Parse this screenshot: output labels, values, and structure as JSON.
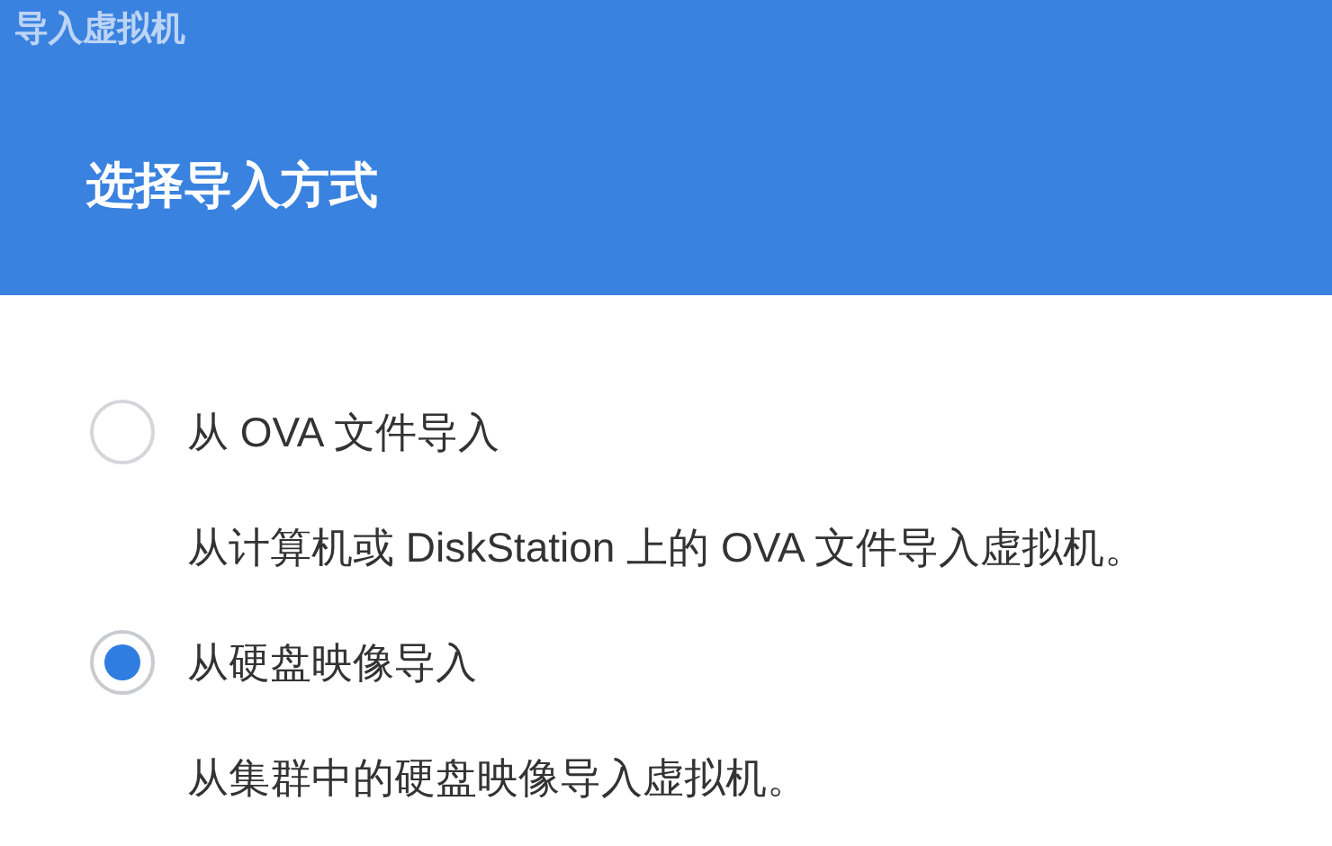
{
  "window": {
    "title": "导入虚拟机"
  },
  "heading": "选择导入方式",
  "options": [
    {
      "label": "从 OVA 文件导入",
      "description": "从计算机或 DiskStation 上的 OVA 文件导入虚拟机。",
      "selected": false
    },
    {
      "label": "从硬盘映像导入",
      "description": "从集群中的硬盘映像导入虚拟机。",
      "selected": true
    }
  ]
}
